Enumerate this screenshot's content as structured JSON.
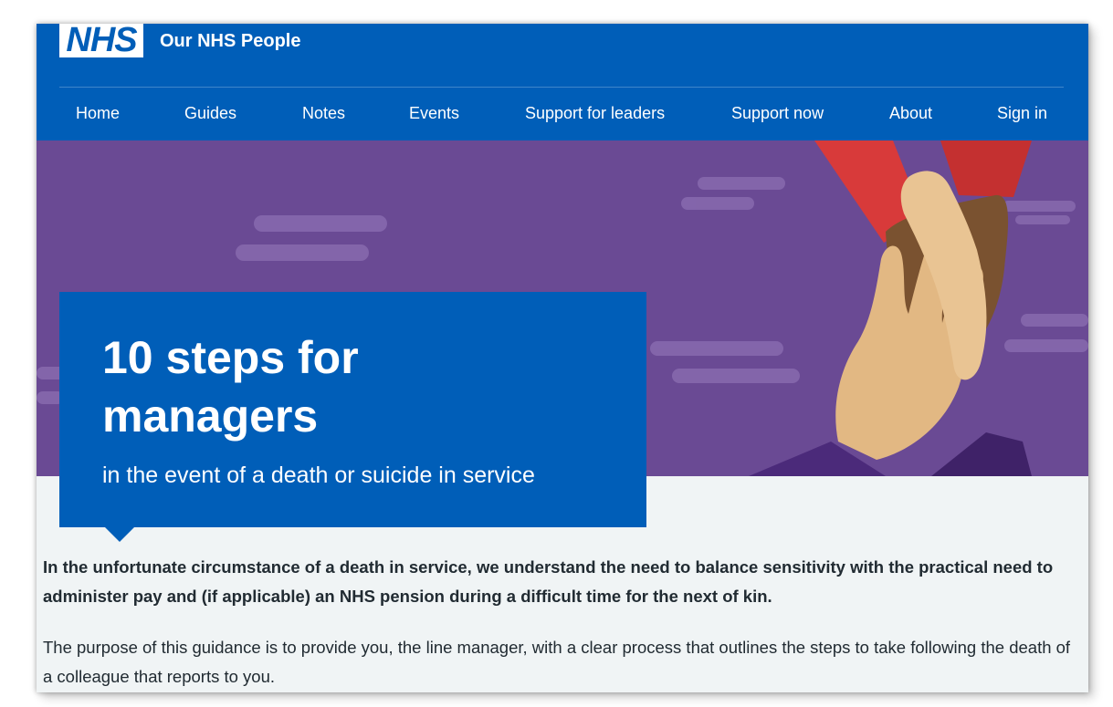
{
  "header": {
    "logo_text": "NHS",
    "service_name": "Our NHS People"
  },
  "nav": {
    "items": [
      {
        "label": "Home"
      },
      {
        "label": "Guides"
      },
      {
        "label": "Notes"
      },
      {
        "label": "Events"
      },
      {
        "label": "Support for leaders"
      },
      {
        "label": "Support now"
      },
      {
        "label": "About"
      },
      {
        "label": "Sign in"
      }
    ]
  },
  "hero": {
    "title": "10 steps for managers",
    "subtitle": "in the event of a death or suicide in service",
    "illustration_icon": "hands-holding-icon"
  },
  "content": {
    "intro_bold": "In the unfortunate circumstance of a death in service, we understand the need to balance sensitivity with the practical need to administer pay and (if applicable) an NHS pension during a difficult time for the next of kin.",
    "intro": "The purpose of this guidance is to provide you, the line manager, with a clear process that outlines the steps to take following the death of a colleague that reports to you."
  },
  "colors": {
    "nhs_blue": "#005eb8",
    "hero_purple": "#6a4a94",
    "page_bg": "#f0f4f5",
    "text": "#212b32"
  }
}
